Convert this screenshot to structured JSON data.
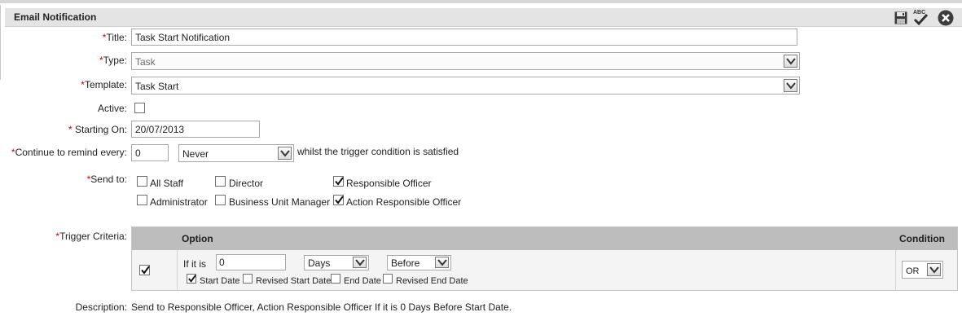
{
  "panel": {
    "title": "Email Notification"
  },
  "toolbar": {
    "icons": [
      "save-icon",
      "spellcheck-icon",
      "close-icon"
    ],
    "spell_text": "ABC"
  },
  "required_marker": "*",
  "form": {
    "title_label": "Title:",
    "title_value": "Task Start Notification",
    "type_label": "Type:",
    "type_value": "Task",
    "template_label": "Template:",
    "template_value": "Task Start",
    "active_label": "Active:",
    "active_checked": false,
    "starting_label": "Starting On:",
    "starting_value": "20/07/2013",
    "remind_label": "Continue to remind every:",
    "remind_value": "0",
    "remind_unit": "Never",
    "remind_suffix": "whilst the trigger condition is satisfied",
    "sendto_label": "Send to:",
    "recipients": [
      {
        "label": "All Staff",
        "checked": false
      },
      {
        "label": "Director",
        "checked": false
      },
      {
        "label": "Responsible Officer",
        "checked": true
      },
      {
        "label": "Administrator",
        "checked": false
      },
      {
        "label": "Business Unit Manager",
        "checked": false
      },
      {
        "label": "Action Responsible Officer",
        "checked": true
      }
    ],
    "trigger_label": "Trigger Criteria:",
    "description_label": "Description:",
    "description_value": "Send to Responsible Officer, Action Responsible Officer If it is 0 Days Before Start Date."
  },
  "trigger_table": {
    "headers": {
      "option": "Option",
      "condition": "Condition"
    },
    "row": {
      "checked": true,
      "if_label": "If it is",
      "amount": "0",
      "unit": "Days",
      "relation": "Before",
      "condition": "OR",
      "dates": [
        {
          "label": "Start Date",
          "checked": true
        },
        {
          "label": "Revised Start Date",
          "checked": false
        },
        {
          "label": "End Date",
          "checked": false
        },
        {
          "label": "Revised End Date",
          "checked": false
        }
      ]
    }
  }
}
